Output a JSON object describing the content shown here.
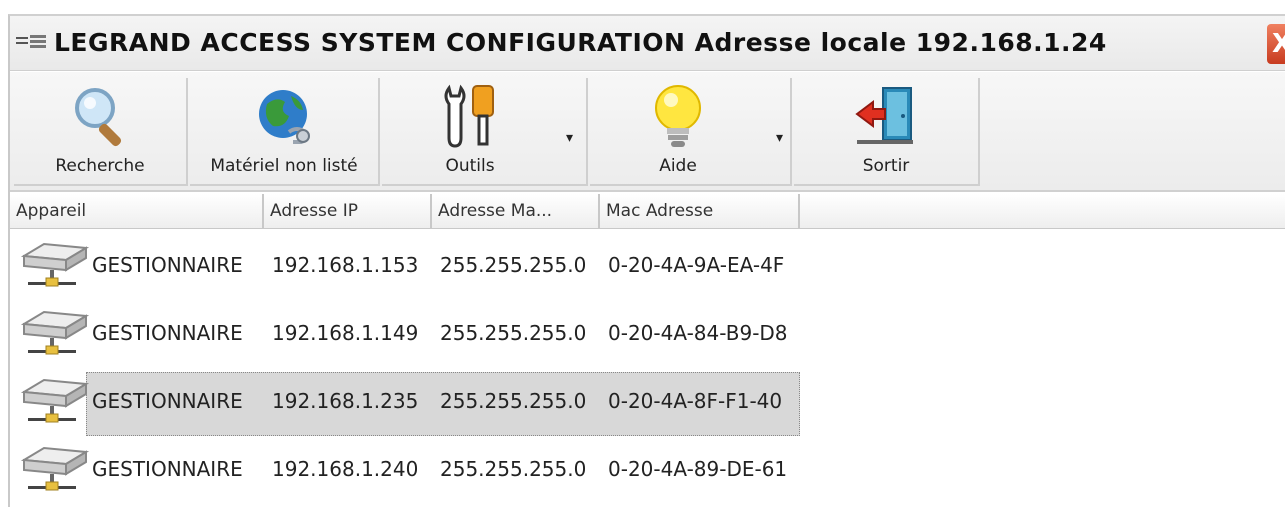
{
  "window": {
    "title": "LEGRAND ACCESS SYSTEM CONFIGURATION Adresse locale 192.168.1.24",
    "close_glyph": "X"
  },
  "toolbar": {
    "buttons": [
      {
        "label": "Recherche",
        "icon": "magnifier-icon"
      },
      {
        "label": "Matériel non listé",
        "icon": "globe-network-icon"
      },
      {
        "label": "Outils",
        "icon": "tools-icon",
        "has_dropdown": true
      },
      {
        "label": "Aide",
        "icon": "lightbulb-icon",
        "has_dropdown": true
      },
      {
        "label": "Sortir",
        "icon": "exit-door-icon"
      }
    ],
    "dropdown_glyph": "▾"
  },
  "list": {
    "columns": [
      "Appareil",
      "Adresse IP",
      "Adresse Ma...",
      "Mac Adresse"
    ],
    "rows": [
      {
        "device": "GESTIONNAIRE",
        "ip": "192.168.1.153",
        "mask": "255.255.255.0",
        "mac": "0-20-4A-9A-EA-4F"
      },
      {
        "device": "GESTIONNAIRE",
        "ip": "192.168.1.149",
        "mask": "255.255.255.0",
        "mac": "0-20-4A-84-B9-D8"
      },
      {
        "device": "GESTIONNAIRE",
        "ip": "192.168.1.235",
        "mask": "255.255.255.0",
        "mac": "0-20-4A-8F-F1-40",
        "selected": true
      },
      {
        "device": "GESTIONNAIRE",
        "ip": "192.168.1.240",
        "mask": "255.255.255.0",
        "mac": "0-20-4A-89-DE-61"
      }
    ]
  },
  "colors": {
    "selection": "#d8d8d8",
    "close_button": "#c83c20"
  }
}
